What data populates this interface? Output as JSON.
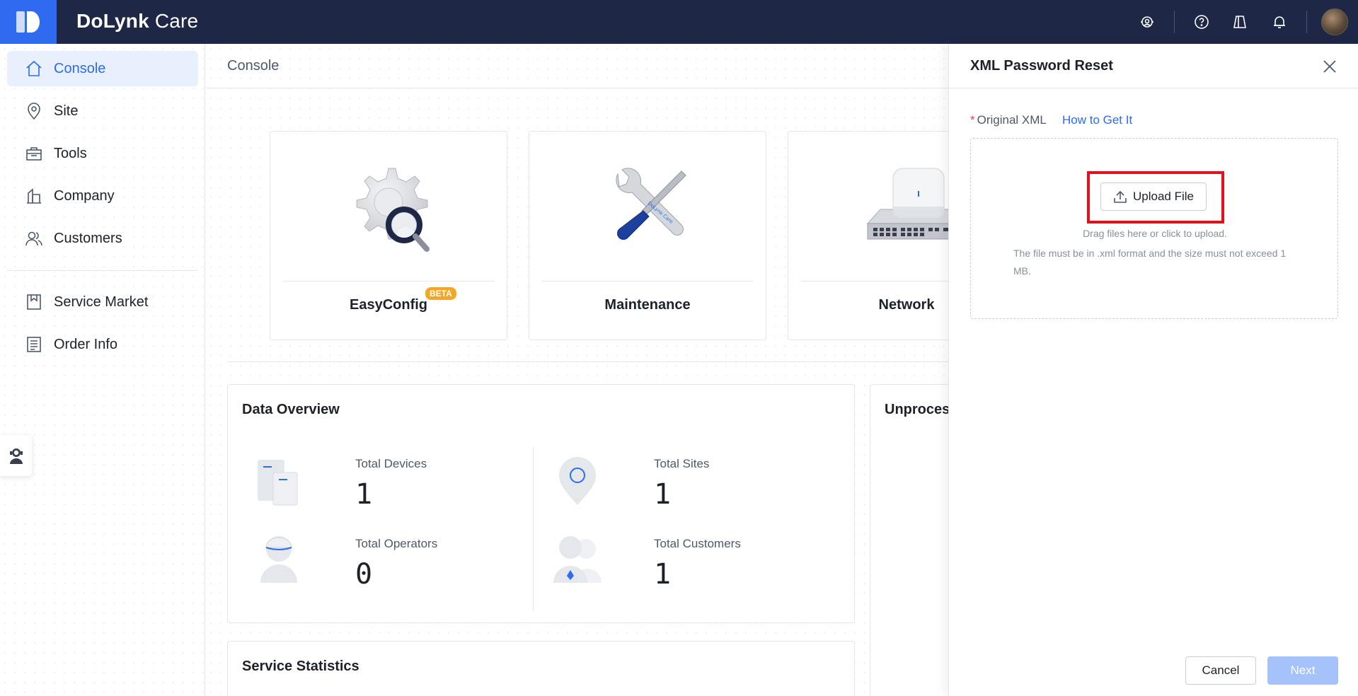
{
  "app": {
    "brand_bold": "DoLynk",
    "brand_light": "Care"
  },
  "topbar": {
    "icons": [
      "service-agent-icon",
      "help-icon",
      "store-icon",
      "bell-icon",
      "user-avatar"
    ]
  },
  "sidebar": {
    "items": [
      {
        "label": "Console",
        "icon": "home-icon",
        "active": true
      },
      {
        "label": "Site",
        "icon": "location-pin-icon"
      },
      {
        "label": "Tools",
        "icon": "toolbox-icon"
      },
      {
        "label": "Company",
        "icon": "building-icon"
      },
      {
        "label": "Customers",
        "icon": "users-icon"
      },
      {
        "label": "Service Market",
        "icon": "bookmark-icon"
      },
      {
        "label": "Order Info",
        "icon": "document-list-icon"
      }
    ]
  },
  "main": {
    "title": "Console",
    "features": [
      {
        "label": "EasyConfig",
        "badge": "BETA",
        "icon": "gear-magnifier-icon"
      },
      {
        "label": "Maintenance",
        "icon": "wrench-screwdriver-icon"
      },
      {
        "label": "Network",
        "icon": "access-point-switch-icon"
      }
    ],
    "data_overview": {
      "title": "Data Overview",
      "stats": [
        {
          "label": "Total Devices",
          "value": "1",
          "icon": "devices-icon"
        },
        {
          "label": "Total Sites",
          "value": "1",
          "icon": "site-pin-icon"
        },
        {
          "label": "Total Operators",
          "value": "0",
          "icon": "operator-icon"
        },
        {
          "label": "Total Customers",
          "value": "1",
          "icon": "customers-icon"
        }
      ]
    },
    "unprocessed_title": "Unprocess",
    "service_statistics_title": "Service Statistics"
  },
  "drawer": {
    "title": "XML Password Reset",
    "required_mark": "*",
    "field_label": "Original XML",
    "how_to_link": "How to Get It",
    "upload_button": "Upload File",
    "hint_drag": "Drag files here or click to upload.",
    "hint_rule": "The file must be in .xml format and the size must not exceed 1 MB.",
    "cancel": "Cancel",
    "next": "Next"
  },
  "colors": {
    "topbar": "#1f2746",
    "accent": "#2e6bf0",
    "highlight": "#e0121b",
    "next_disabled": "#a6c2fb"
  }
}
